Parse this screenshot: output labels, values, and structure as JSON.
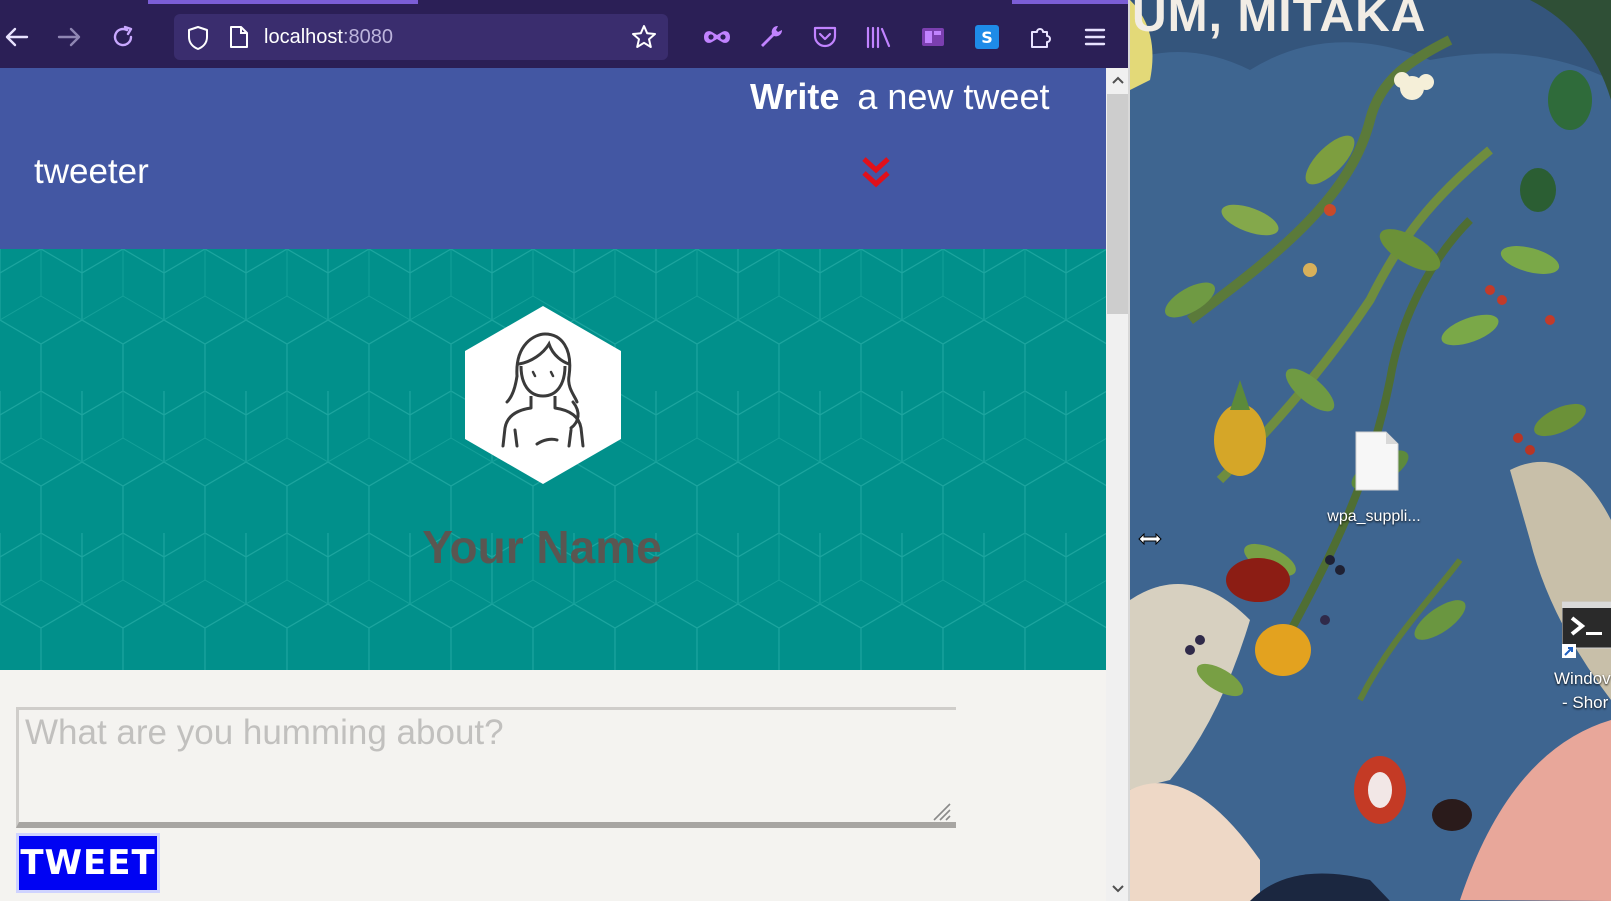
{
  "browser": {
    "url_host": "localhost",
    "url_port": ":8080",
    "icons": {
      "back": "arrow-left-icon",
      "forward": "arrow-right-icon",
      "reload": "reload-icon",
      "shield": "tracking-shield-icon",
      "page": "page-icon",
      "bookmark": "star-icon",
      "private": "mask-icon",
      "devtools": "wrench-icon",
      "pocket": "pocket-icon",
      "library": "library-icon",
      "sidebar": "sidebar-icon",
      "extension_s": "extension-s-icon",
      "extensions": "puzzle-icon",
      "menu": "hamburger-menu-icon"
    },
    "colors": {
      "toolbar": "#2b1f56",
      "urlbar": "#3a2d6e"
    }
  },
  "page": {
    "brand": "tweeter",
    "write_bold": "Write",
    "write_rest": "a new tweet",
    "profile_name": "Your Name",
    "compose_placeholder": "What are you humming about?",
    "tweet_button": "TWEET",
    "colors": {
      "header": "#4357a3",
      "profile_bg": "#01908b",
      "chevron": "#e1101a",
      "tweet_button": "#0003f3"
    }
  },
  "desktop": {
    "wallpaper_text": "UM, MITAKA",
    "file_label": "wpa_suppli...",
    "shortcut_label_line1": "Windov",
    "shortcut_label_line2": "- Shor"
  }
}
